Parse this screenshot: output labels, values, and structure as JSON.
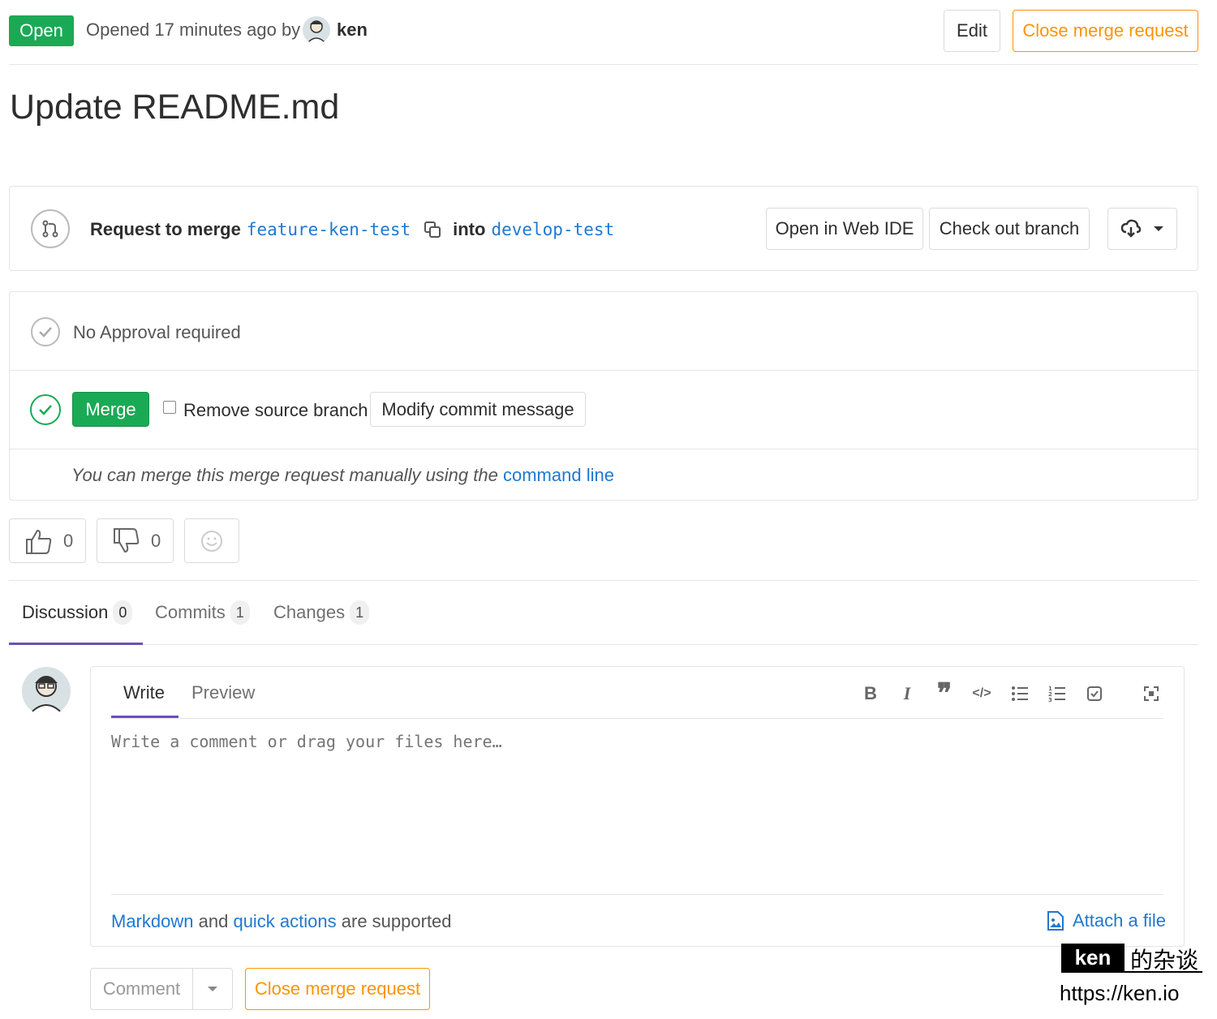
{
  "header": {
    "status_badge": "Open",
    "opened_text": "Opened 17 minutes ago by",
    "author": "ken",
    "edit_label": "Edit",
    "close_label": "Close merge request"
  },
  "title": "Update README.md",
  "merge_info": {
    "prefix": "Request to merge",
    "source_branch": "feature-ken-test",
    "into": "into",
    "target_branch": "develop-test",
    "open_web_ide": "Open in Web IDE",
    "check_out_branch": "Check out branch"
  },
  "approval": {
    "text": "No Approval required"
  },
  "merge": {
    "merge_label": "Merge",
    "remove_source_branch": "Remove source branch",
    "modify_commit": "Modify commit message",
    "manual_text": "You can merge this merge request manually using the",
    "command_line": "command line"
  },
  "reactions": {
    "thumbs_up": "0",
    "thumbs_down": "0"
  },
  "tabs": [
    {
      "label": "Discussion",
      "count": "0"
    },
    {
      "label": "Commits",
      "count": "1"
    },
    {
      "label": "Changes",
      "count": "1"
    }
  ],
  "editor": {
    "write_tab": "Write",
    "preview_tab": "Preview",
    "placeholder": "Write a comment or drag your files here…",
    "markdown_link": "Markdown",
    "and_text": "and",
    "quick_actions_link": "quick actions",
    "supported_text": "are supported",
    "attach_label": "Attach a file"
  },
  "footer_buttons": {
    "comment_label": "Comment",
    "close_label": "Close merge request"
  },
  "watermark": {
    "name": "ken",
    "chinese": "的杂谈",
    "url": "https://ken.io"
  },
  "colors": {
    "green": "#1aaa55",
    "orange": "#fc9403",
    "link": "#1f78d1",
    "tab_active": "#6b4fbb"
  }
}
